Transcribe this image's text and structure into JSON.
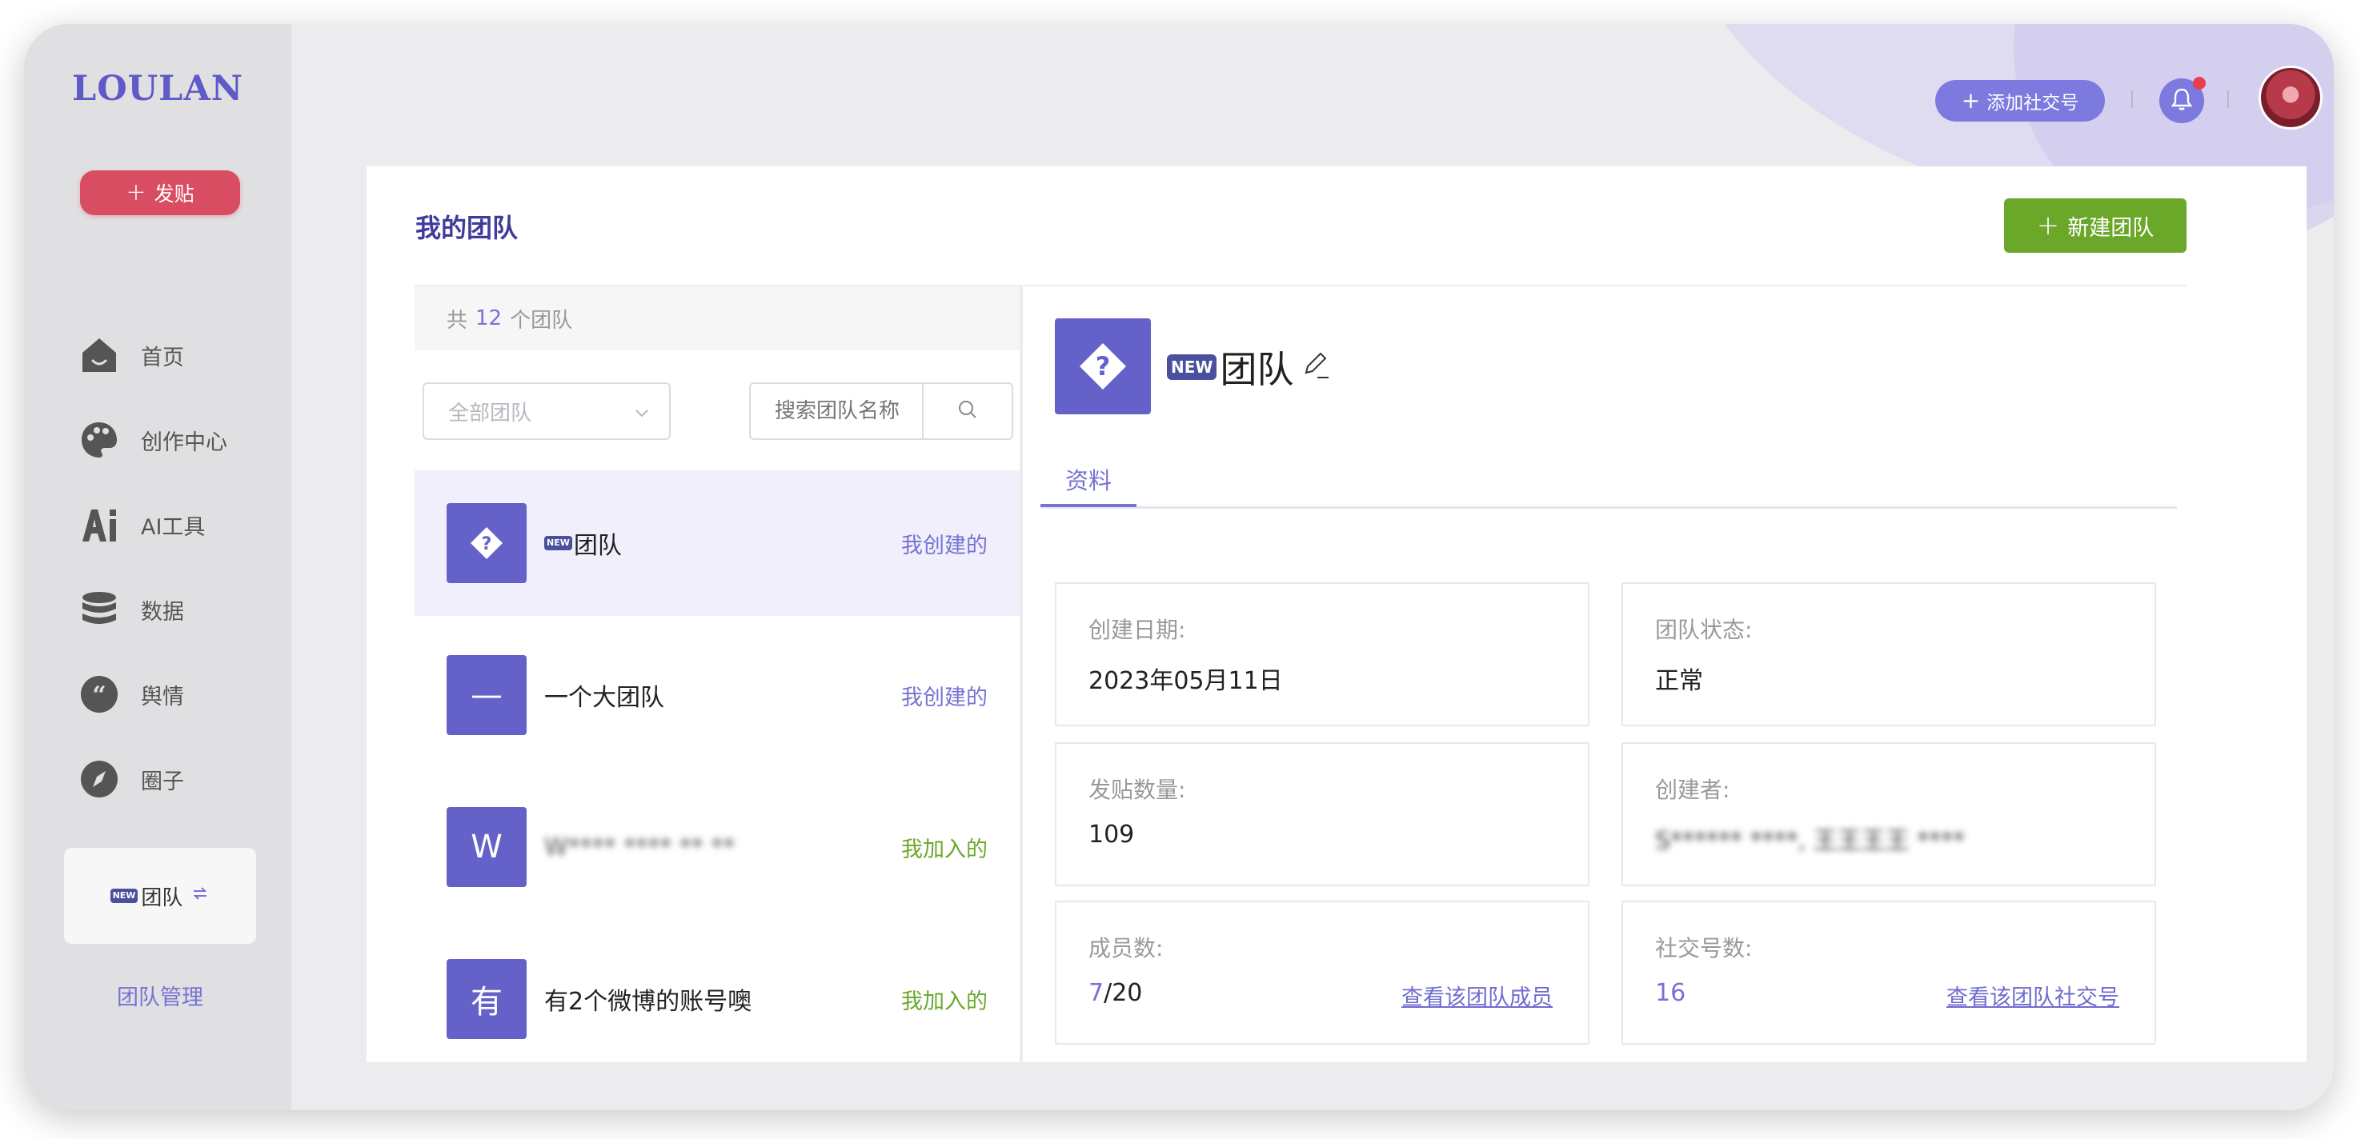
{
  "app": {
    "logo": "LOULAN",
    "brand_color": "#5f5ac7",
    "accent_color": "#7673d3",
    "success_color": "#6ba82a",
    "danger_color": "#d94d63"
  },
  "sidebar": {
    "post_button": "发贴",
    "items": [
      {
        "label": "首页",
        "icon": "home-icon"
      },
      {
        "label": "创作中心",
        "icon": "palette-icon"
      },
      {
        "label": "AI工具",
        "icon": "ai-icon"
      },
      {
        "label": "数据",
        "icon": "database-icon"
      },
      {
        "label": "舆情",
        "icon": "quote-icon"
      },
      {
        "label": "圈子",
        "icon": "compass-icon"
      }
    ],
    "team_switch": {
      "badge": "NEW",
      "label": "团队"
    },
    "team_manage": "团队管理"
  },
  "topbar": {
    "add_social": "添加社交号"
  },
  "main": {
    "title": "我的团队",
    "new_team_button": "新建团队",
    "list": {
      "count_prefix": "共",
      "count": "12",
      "count_suffix": "个团队",
      "filter_placeholder": "全部团队",
      "search_placeholder": "搜索团队名称",
      "teams": [
        {
          "avatar": "?",
          "badge": "NEW",
          "name": "团队",
          "role": "我创建的",
          "role_type": "created"
        },
        {
          "avatar": "—",
          "name": "一个大团队",
          "role": "我创建的",
          "role_type": "created"
        },
        {
          "avatar": "W",
          "name": "W**** **** ** **",
          "role": "我加入的",
          "role_type": "joined"
        },
        {
          "avatar": "有",
          "name": "有2个微博的账号噢",
          "role": "我加入的",
          "role_type": "joined"
        }
      ]
    },
    "detail": {
      "badge": "NEW",
      "name": "团队",
      "tab": "资料",
      "fields": {
        "created_date_label": "创建日期:",
        "created_date": "2023年05月11日",
        "status_label": "团队状态:",
        "status": "正常",
        "posts_label": "发贴数量:",
        "posts": "109",
        "creator_label": "创建者:",
        "creator": "S****** ****, 王王王王 ****",
        "members_label": "成员数:",
        "members_current": "7",
        "members_total": "/20",
        "members_link": "查看该团队成员",
        "social_label": "社交号数:",
        "social_count": "16",
        "social_link": "查看该团队社交号"
      }
    }
  }
}
